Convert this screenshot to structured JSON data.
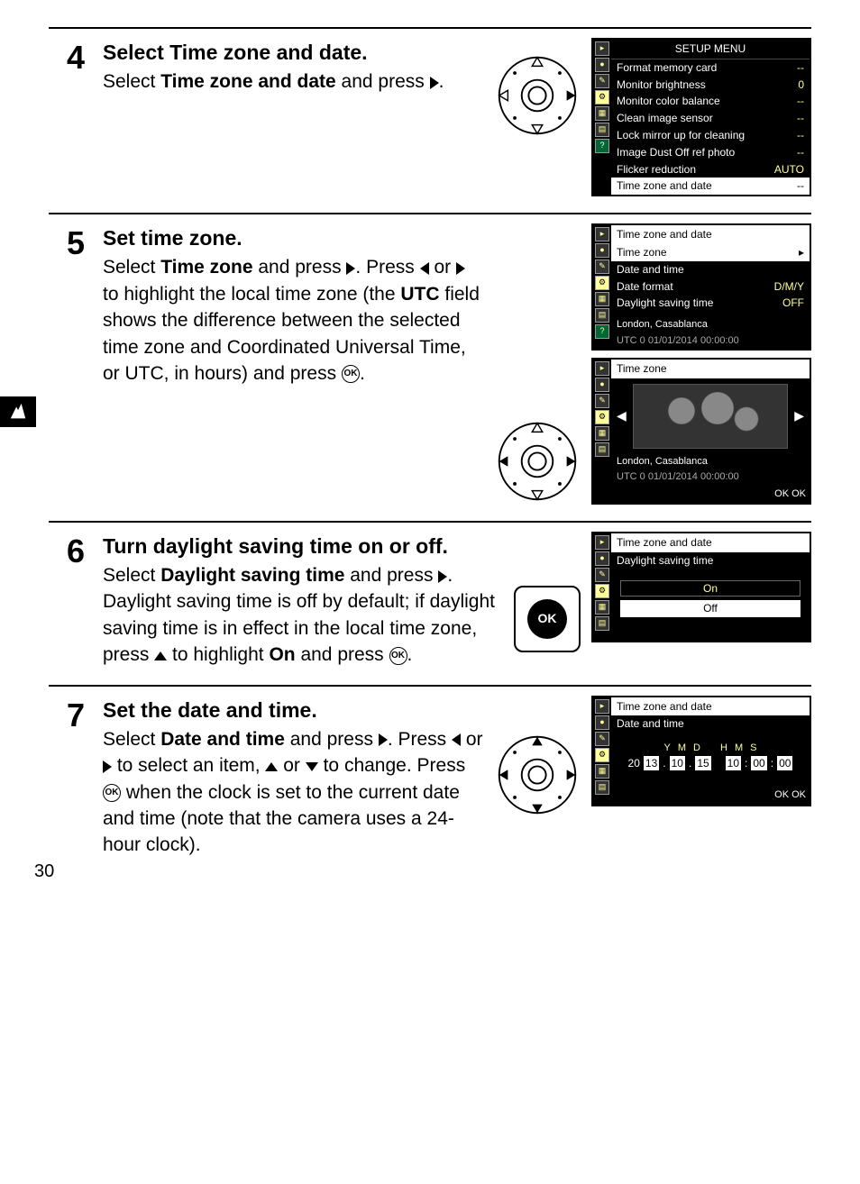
{
  "page_number": "30",
  "steps": [
    {
      "num": "4",
      "title": "Select Time zone and date.",
      "desc_parts": [
        "Select ",
        "<b>Time zone and date</b>",
        " and press ",
        "<tri-r>",
        "."
      ]
    },
    {
      "num": "5",
      "title": "Set time zone.",
      "desc_parts": [
        "Select ",
        "<b>Time zone</b>",
        " and press ",
        "<tri-r>",
        ".  Press ",
        "<tri-l>",
        " or ",
        "<tri-r>",
        " to highlight the local time zone (the ",
        "<b>UTC</b>",
        " field shows the difference between the selected time zone and Coordinated Universal Time, or UTC, in hours) and press ",
        "<ok>",
        "."
      ]
    },
    {
      "num": "6",
      "title": "Turn daylight saving time on or off.",
      "desc_parts": [
        "Select ",
        "<b>Daylight saving time</b>",
        " and press ",
        "<tri-r>",
        ".  Daylight saving time is off by default; if daylight saving time is in effect in the local time zone, press ",
        "<tri-u>",
        " to highlight ",
        "<b>On</b>",
        " and press ",
        "<ok>",
        "."
      ]
    },
    {
      "num": "7",
      "title": "Set the date and time.",
      "desc_parts": [
        "Select ",
        "<b>Date and time</b>",
        " and press ",
        "<tri-r>",
        ".  Press ",
        "<tri-l>",
        " or ",
        "<tri-r>",
        " to select an item, ",
        "<tri-u>",
        " or ",
        "<tri-d>",
        " to change.  Press ",
        "<ok>",
        " when the clock is set to the current date and time (note that the camera uses a 24-hour clock)."
      ]
    }
  ],
  "setup_menu": {
    "title": "SETUP MENU",
    "rows": [
      {
        "label": "Format memory card",
        "value": "--"
      },
      {
        "label": "Monitor brightness",
        "value": "0"
      },
      {
        "label": "Monitor color balance",
        "value": "--"
      },
      {
        "label": "Clean image sensor",
        "value": "--"
      },
      {
        "label": "Lock mirror up for cleaning",
        "value": "--"
      },
      {
        "label": "Image Dust Off ref photo",
        "value": "--"
      },
      {
        "label": "Flicker reduction",
        "value": "AUTO"
      },
      {
        "label": "Time zone and date",
        "value": "--",
        "selected": true
      }
    ]
  },
  "tz_date_menu": {
    "title": "Time zone and date",
    "rows": [
      {
        "label": "Time zone",
        "value": "",
        "selected": true,
        "arrow": true
      },
      {
        "label": "Date and time",
        "value": ""
      },
      {
        "label": "Date format",
        "value": "D/M/Y"
      },
      {
        "label": "Daylight saving time",
        "value": "OFF"
      }
    ],
    "location": "London, Casablanca",
    "utc": "UTC 0    01/01/2014 00:00:00"
  },
  "tz_map": {
    "title": "Time zone",
    "location": "London, Casablanca",
    "utc": "UTC 0    01/01/2014 00:00:00",
    "ok": "OK OK"
  },
  "dst_menu": {
    "title": "Time zone and date",
    "subtitle": "Daylight saving time",
    "on": "On",
    "off": "Off"
  },
  "dt_menu": {
    "title": "Time zone and date",
    "subtitle": "Date and time",
    "labels": [
      "Y",
      "M",
      "D",
      "H",
      "M",
      "S"
    ],
    "year_prefix": "20",
    "values": [
      "13",
      "10",
      "15",
      "10",
      "00",
      "00"
    ],
    "ok": "OK OK"
  }
}
